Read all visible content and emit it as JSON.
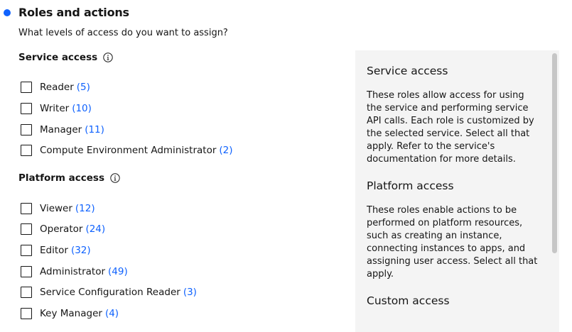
{
  "section": {
    "title": "Roles and actions",
    "subtitle": "What levels of access do you want to assign?"
  },
  "service_access": {
    "title": "Service access",
    "roles": [
      {
        "label": "Reader",
        "count": "(5)"
      },
      {
        "label": "Writer",
        "count": "(10)"
      },
      {
        "label": "Manager",
        "count": "(11)"
      },
      {
        "label": "Compute Environment Administrator",
        "count": "(2)"
      }
    ]
  },
  "platform_access": {
    "title": "Platform access",
    "roles": [
      {
        "label": "Viewer",
        "count": "(12)"
      },
      {
        "label": "Operator",
        "count": "(24)"
      },
      {
        "label": "Editor",
        "count": "(32)"
      },
      {
        "label": "Administrator",
        "count": "(49)"
      },
      {
        "label": "Service Configuration Reader",
        "count": "(3)"
      },
      {
        "label": "Key Manager",
        "count": "(4)"
      }
    ]
  },
  "help_panel": {
    "service_heading": "Service access",
    "service_lines": [
      "These roles allow access for using",
      "the service and performing service",
      "API calls. Each role is customized by",
      "the selected service. Select all that",
      "apply. Refer to the service's",
      "documentation for more details."
    ],
    "platform_heading": "Platform access",
    "platform_lines": [
      "These roles enable actions to be",
      "performed on platform resources,",
      "such as creating an instance,",
      "connecting instances to apps, and",
      "assigning user access. Select all that",
      "apply."
    ],
    "custom_heading": "Custom access"
  },
  "colors": {
    "accent": "#0f62fe",
    "panel_bg": "#f4f4f4",
    "text": "#161616"
  }
}
